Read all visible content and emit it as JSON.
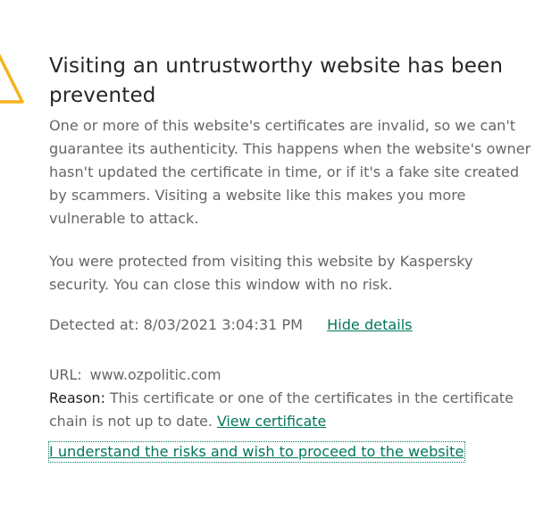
{
  "warning": {
    "title": "Visiting an untrustworthy website has been prevented",
    "icon": "warning-triangle-icon",
    "icon_color": "#f5b21b"
  },
  "description": "One or more of this website's certificates are invalid, so we can't guarantee its authenticity. This happens when the website's owner hasn't updated the certificate in time, or if it's a fake site created by scammers. Visiting a website like this makes you more vulnerable to attack.",
  "protection_note": "You were protected from visiting this website by Kaspersky security. You can close this window with no risk.",
  "detection": {
    "label": "Detected at:",
    "timestamp": "8/03/2021 3:04:31 PM",
    "hide_details_link": "Hide details"
  },
  "details": {
    "url_label": "URL:",
    "url_value": "www.ozpolitic.com",
    "reason_label": "Reason:",
    "reason_text": "This certificate or one of the certificates in the certificate chain is not up to date.",
    "view_certificate_link": "View certificate"
  },
  "proceed_link": "I understand the risks and wish to proceed to the website",
  "colors": {
    "link": "#00775a",
    "title": "#262626",
    "body_text": "#666666"
  }
}
